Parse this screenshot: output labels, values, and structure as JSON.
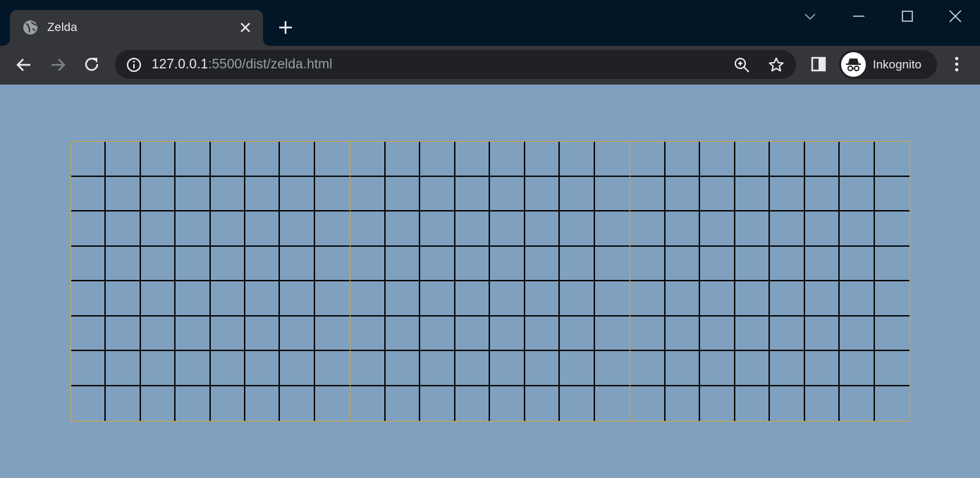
{
  "browser": {
    "tab": {
      "title": "Zelda",
      "favicon": "globe-icon"
    },
    "address": {
      "host": "127.0.0.1",
      "rest": ":5500/dist/zelda.html"
    },
    "profile": {
      "label": "Inkognito",
      "icon": "incognito-icon"
    },
    "colors": {
      "tabstrip": "#011627",
      "toolbar": "#35363a",
      "omnibox": "#202124"
    }
  },
  "page": {
    "background": "#7fa0bf",
    "board": {
      "screens": 3,
      "rows": 8,
      "columns_per_screen": 8,
      "screen_border_color": "#d4a53a",
      "grid_line_color": "#0a0a0a"
    }
  }
}
